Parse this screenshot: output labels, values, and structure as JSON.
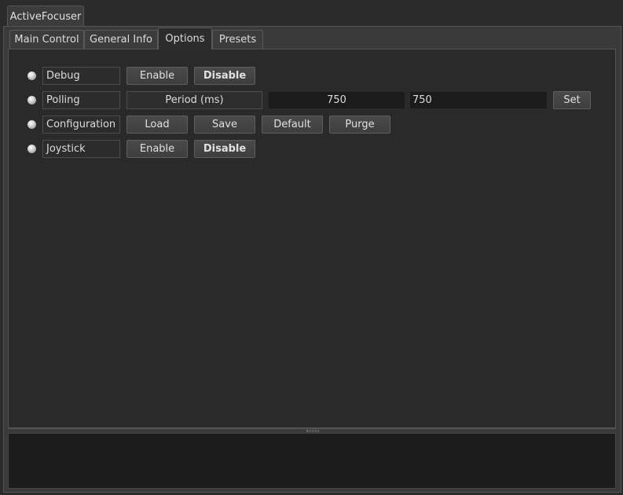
{
  "device": {
    "name": "ActiveFocuser"
  },
  "tabs": [
    {
      "label": "Main Control"
    },
    {
      "label": "General Info"
    },
    {
      "label": "Options"
    },
    {
      "label": "Presets"
    }
  ],
  "active_tab": "Options",
  "options": {
    "debug": {
      "label": "Debug",
      "enable": "Enable",
      "disable": "Disable",
      "selected": "Disable"
    },
    "polling": {
      "label": "Polling",
      "period_label": "Period (ms)",
      "current_value": "750",
      "input_value": "750",
      "set": "Set"
    },
    "configuration": {
      "label": "Configuration",
      "load": "Load",
      "save": "Save",
      "default": "Default",
      "purge": "Purge"
    },
    "joystick": {
      "label": "Joystick",
      "enable": "Enable",
      "disable": "Disable",
      "selected": "Disable"
    }
  },
  "colors": {
    "led": "#d8d8d8",
    "background": "#2b2b2b",
    "field": "#1b1b1b"
  }
}
